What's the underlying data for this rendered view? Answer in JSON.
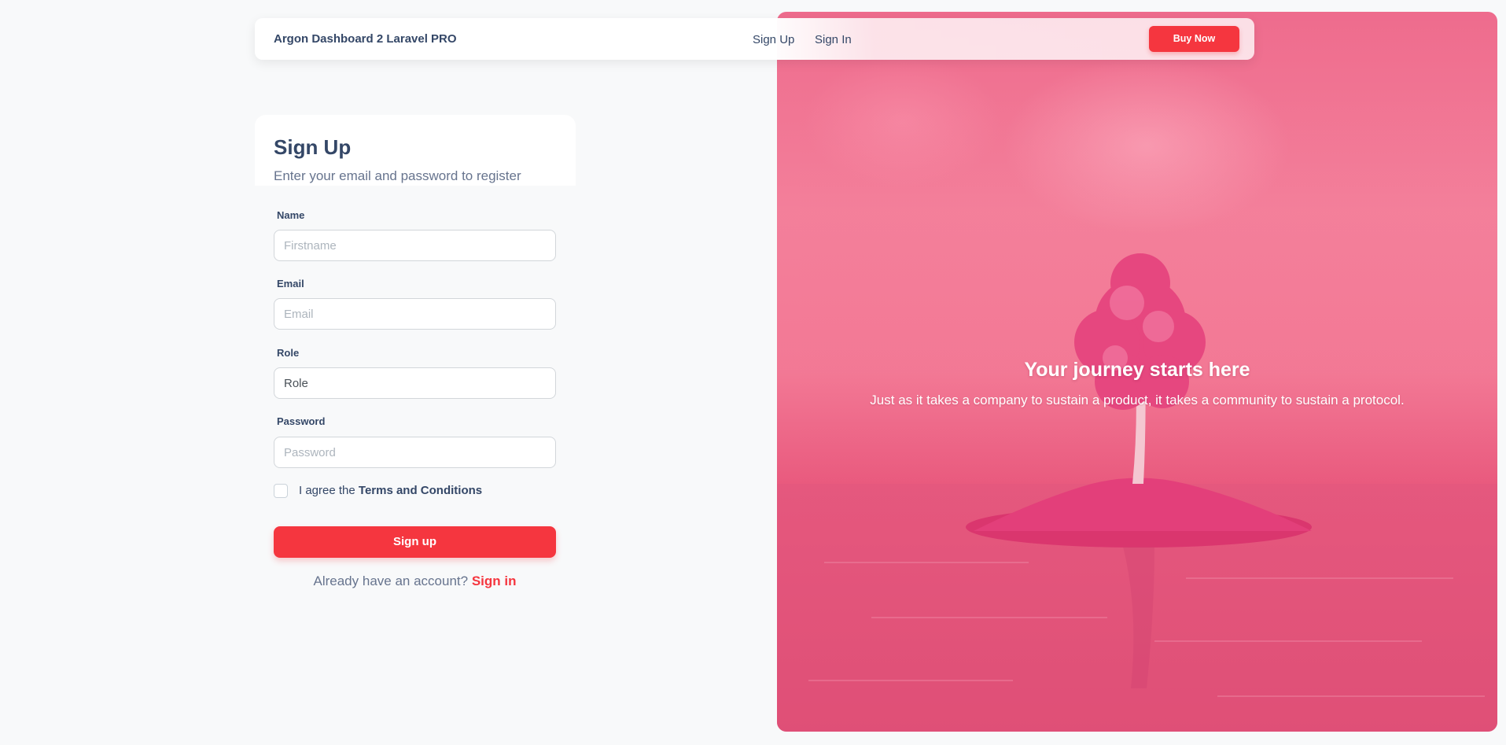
{
  "navbar": {
    "brand": "Argon Dashboard 2 Laravel PRO",
    "links": [
      "Sign Up",
      "Sign In"
    ],
    "buy_label": "Buy Now"
  },
  "form": {
    "title": "Sign Up",
    "subtitle": "Enter your email and password to register",
    "fields": [
      {
        "label": "Name",
        "value": "",
        "placeholder": "Firstname"
      },
      {
        "label": "Email",
        "value": "",
        "placeholder": "Email"
      },
      {
        "label": "Role",
        "value": "Role",
        "placeholder": ""
      },
      {
        "label": "Password",
        "value": "",
        "placeholder": "Password"
      }
    ],
    "agree_prefix": "I agree the",
    "terms_link": "Terms and Conditions",
    "submit_label": "Sign up",
    "footer_prefix": "Already have an account?",
    "footer_link": "Sign in"
  },
  "hero": {
    "title": "Your journey starts here",
    "text": "Just as it takes a company to sustain a product, it takes a community to sustain a protocol."
  },
  "colors": {
    "accent": "#f5363f",
    "text_primary": "#344767",
    "text_secondary": "#67748e",
    "background": "#f8f9fa",
    "hero_pink": "#ec6a8c"
  }
}
